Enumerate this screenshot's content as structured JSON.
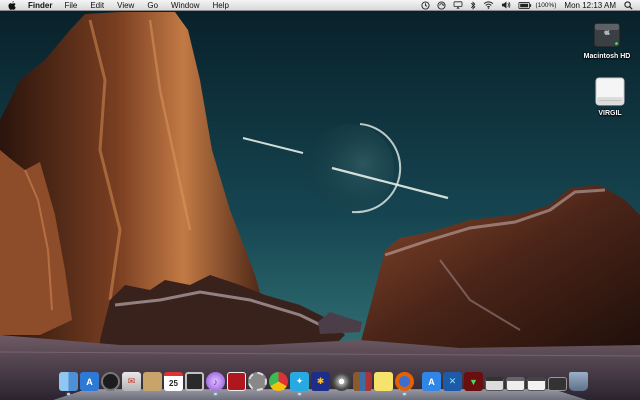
{
  "menubar": {
    "app_name": "Finder",
    "menus": [
      "File",
      "Edit",
      "View",
      "Go",
      "Window",
      "Help"
    ],
    "battery_percent": "(100%)",
    "clock": "Mon 12:13 AM"
  },
  "desktop_icons": [
    {
      "label": "Macintosh HD",
      "icon": "hard-drive-icon"
    },
    {
      "label": "VIRGIL",
      "icon": "external-drive-icon"
    }
  ],
  "dock": {
    "items": [
      {
        "icon": "finder-icon",
        "running": true
      },
      {
        "icon": "app-store-icon",
        "running": false
      },
      {
        "icon": "dashboard-icon",
        "running": false
      },
      {
        "icon": "mail-icon",
        "running": false
      },
      {
        "icon": "contacts-icon",
        "running": false
      },
      {
        "icon": "calendar-icon",
        "running": false,
        "glyph": "25"
      },
      {
        "icon": "photo-booth-icon",
        "running": false
      },
      {
        "icon": "itunes-icon",
        "running": true
      },
      {
        "icon": "preview-pdf-icon",
        "running": false
      },
      {
        "icon": "system-preferences-icon",
        "running": false
      },
      {
        "icon": "chrome-icon",
        "running": false
      },
      {
        "icon": "twitter-icon",
        "running": true
      },
      {
        "icon": "walmart-spark-icon",
        "running": false
      },
      {
        "icon": "dvd-player-icon",
        "running": false
      },
      {
        "icon": "books-icon",
        "running": false
      },
      {
        "icon": "stickies-icon",
        "running": false
      },
      {
        "icon": "firefox-icon",
        "running": true
      },
      {
        "icon": "app-store-blue-icon",
        "running": false
      },
      {
        "icon": "xcode-icon",
        "running": false
      },
      {
        "icon": "download-icon",
        "running": false
      },
      {
        "icon": "window-thumbnail-1-icon",
        "running": false
      },
      {
        "icon": "window-thumbnail-2-icon",
        "running": false
      },
      {
        "icon": "window-thumbnail-3-icon",
        "running": false
      },
      {
        "icon": "window-thumbnail-4-icon",
        "running": false
      },
      {
        "icon": "trash-icon",
        "running": false
      }
    ]
  },
  "colors": {
    "sky_top": "#0a2630",
    "sky_horizon": "#2e6d6f",
    "rock_light": "#c27a45",
    "rock_dark": "#2a140c",
    "snow": "#b8a4a8"
  }
}
